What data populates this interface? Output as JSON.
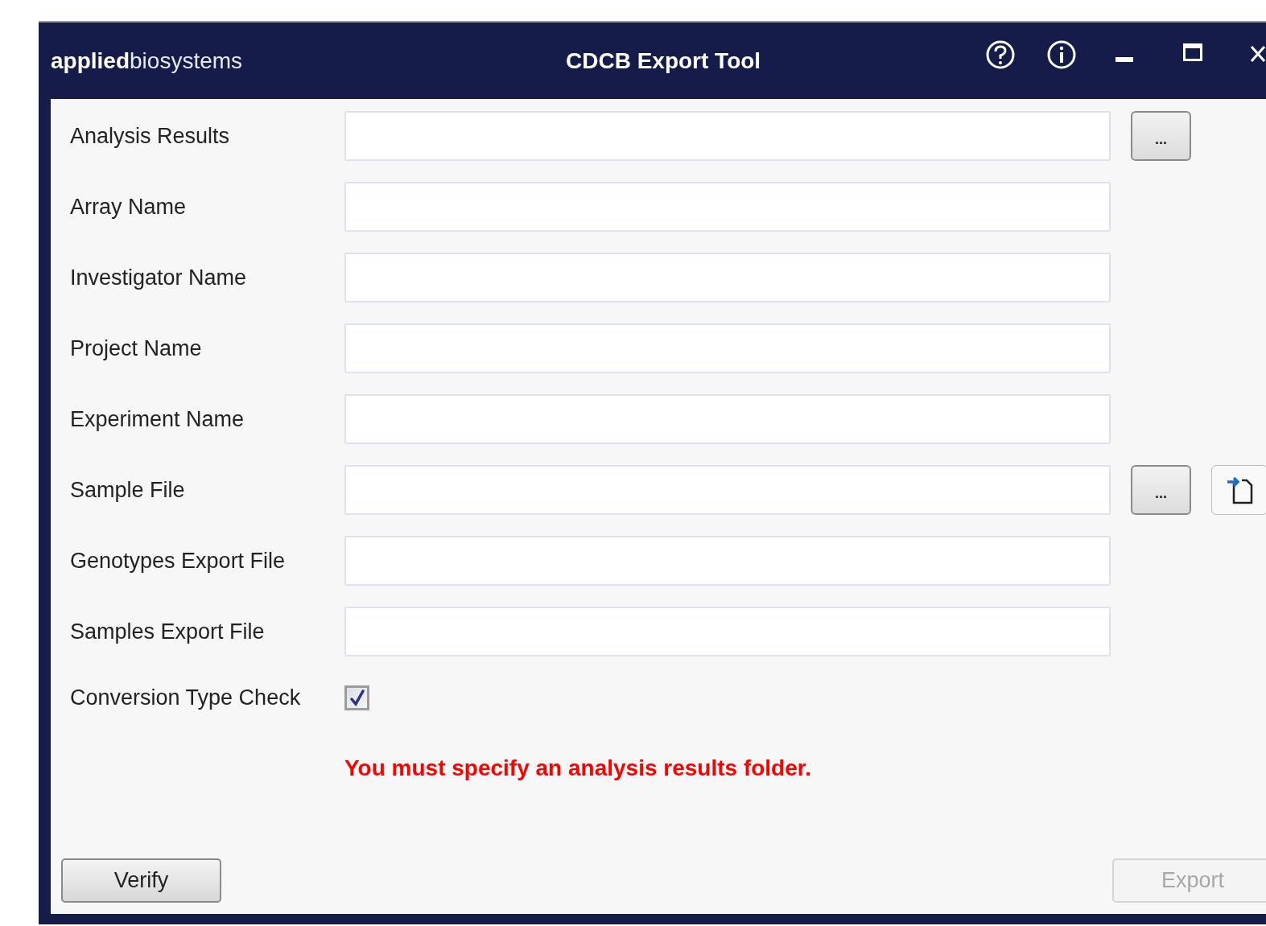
{
  "window": {
    "logo_bold": "applied",
    "logo_light": "biosystems",
    "title": "CDCB Export Tool"
  },
  "rows": [
    {
      "kind": "field",
      "label": "Analysis Results",
      "buttons": [
        {
          "kind": "browse",
          "label": "..."
        }
      ]
    },
    {
      "kind": "field",
      "label": "Array Name"
    },
    {
      "kind": "field",
      "label": "Investigator Name"
    },
    {
      "kind": "field",
      "label": "Project Name"
    },
    {
      "kind": "field",
      "label": "Experiment Name"
    },
    {
      "kind": "field",
      "label": "Sample File",
      "buttons": [
        {
          "kind": "browse",
          "label": "..."
        },
        {
          "kind": "import"
        }
      ]
    },
    {
      "kind": "field",
      "label": "Genotypes Export File"
    },
    {
      "kind": "field",
      "label": "Samples Export File"
    },
    {
      "kind": "checkbox",
      "label": "Conversion Type Check",
      "checked": true
    }
  ],
  "error": "You must specify an analysis results folder.",
  "footer": [
    {
      "label": "Verify",
      "disabled": false
    },
    {
      "label": "Export",
      "disabled": true
    }
  ]
}
